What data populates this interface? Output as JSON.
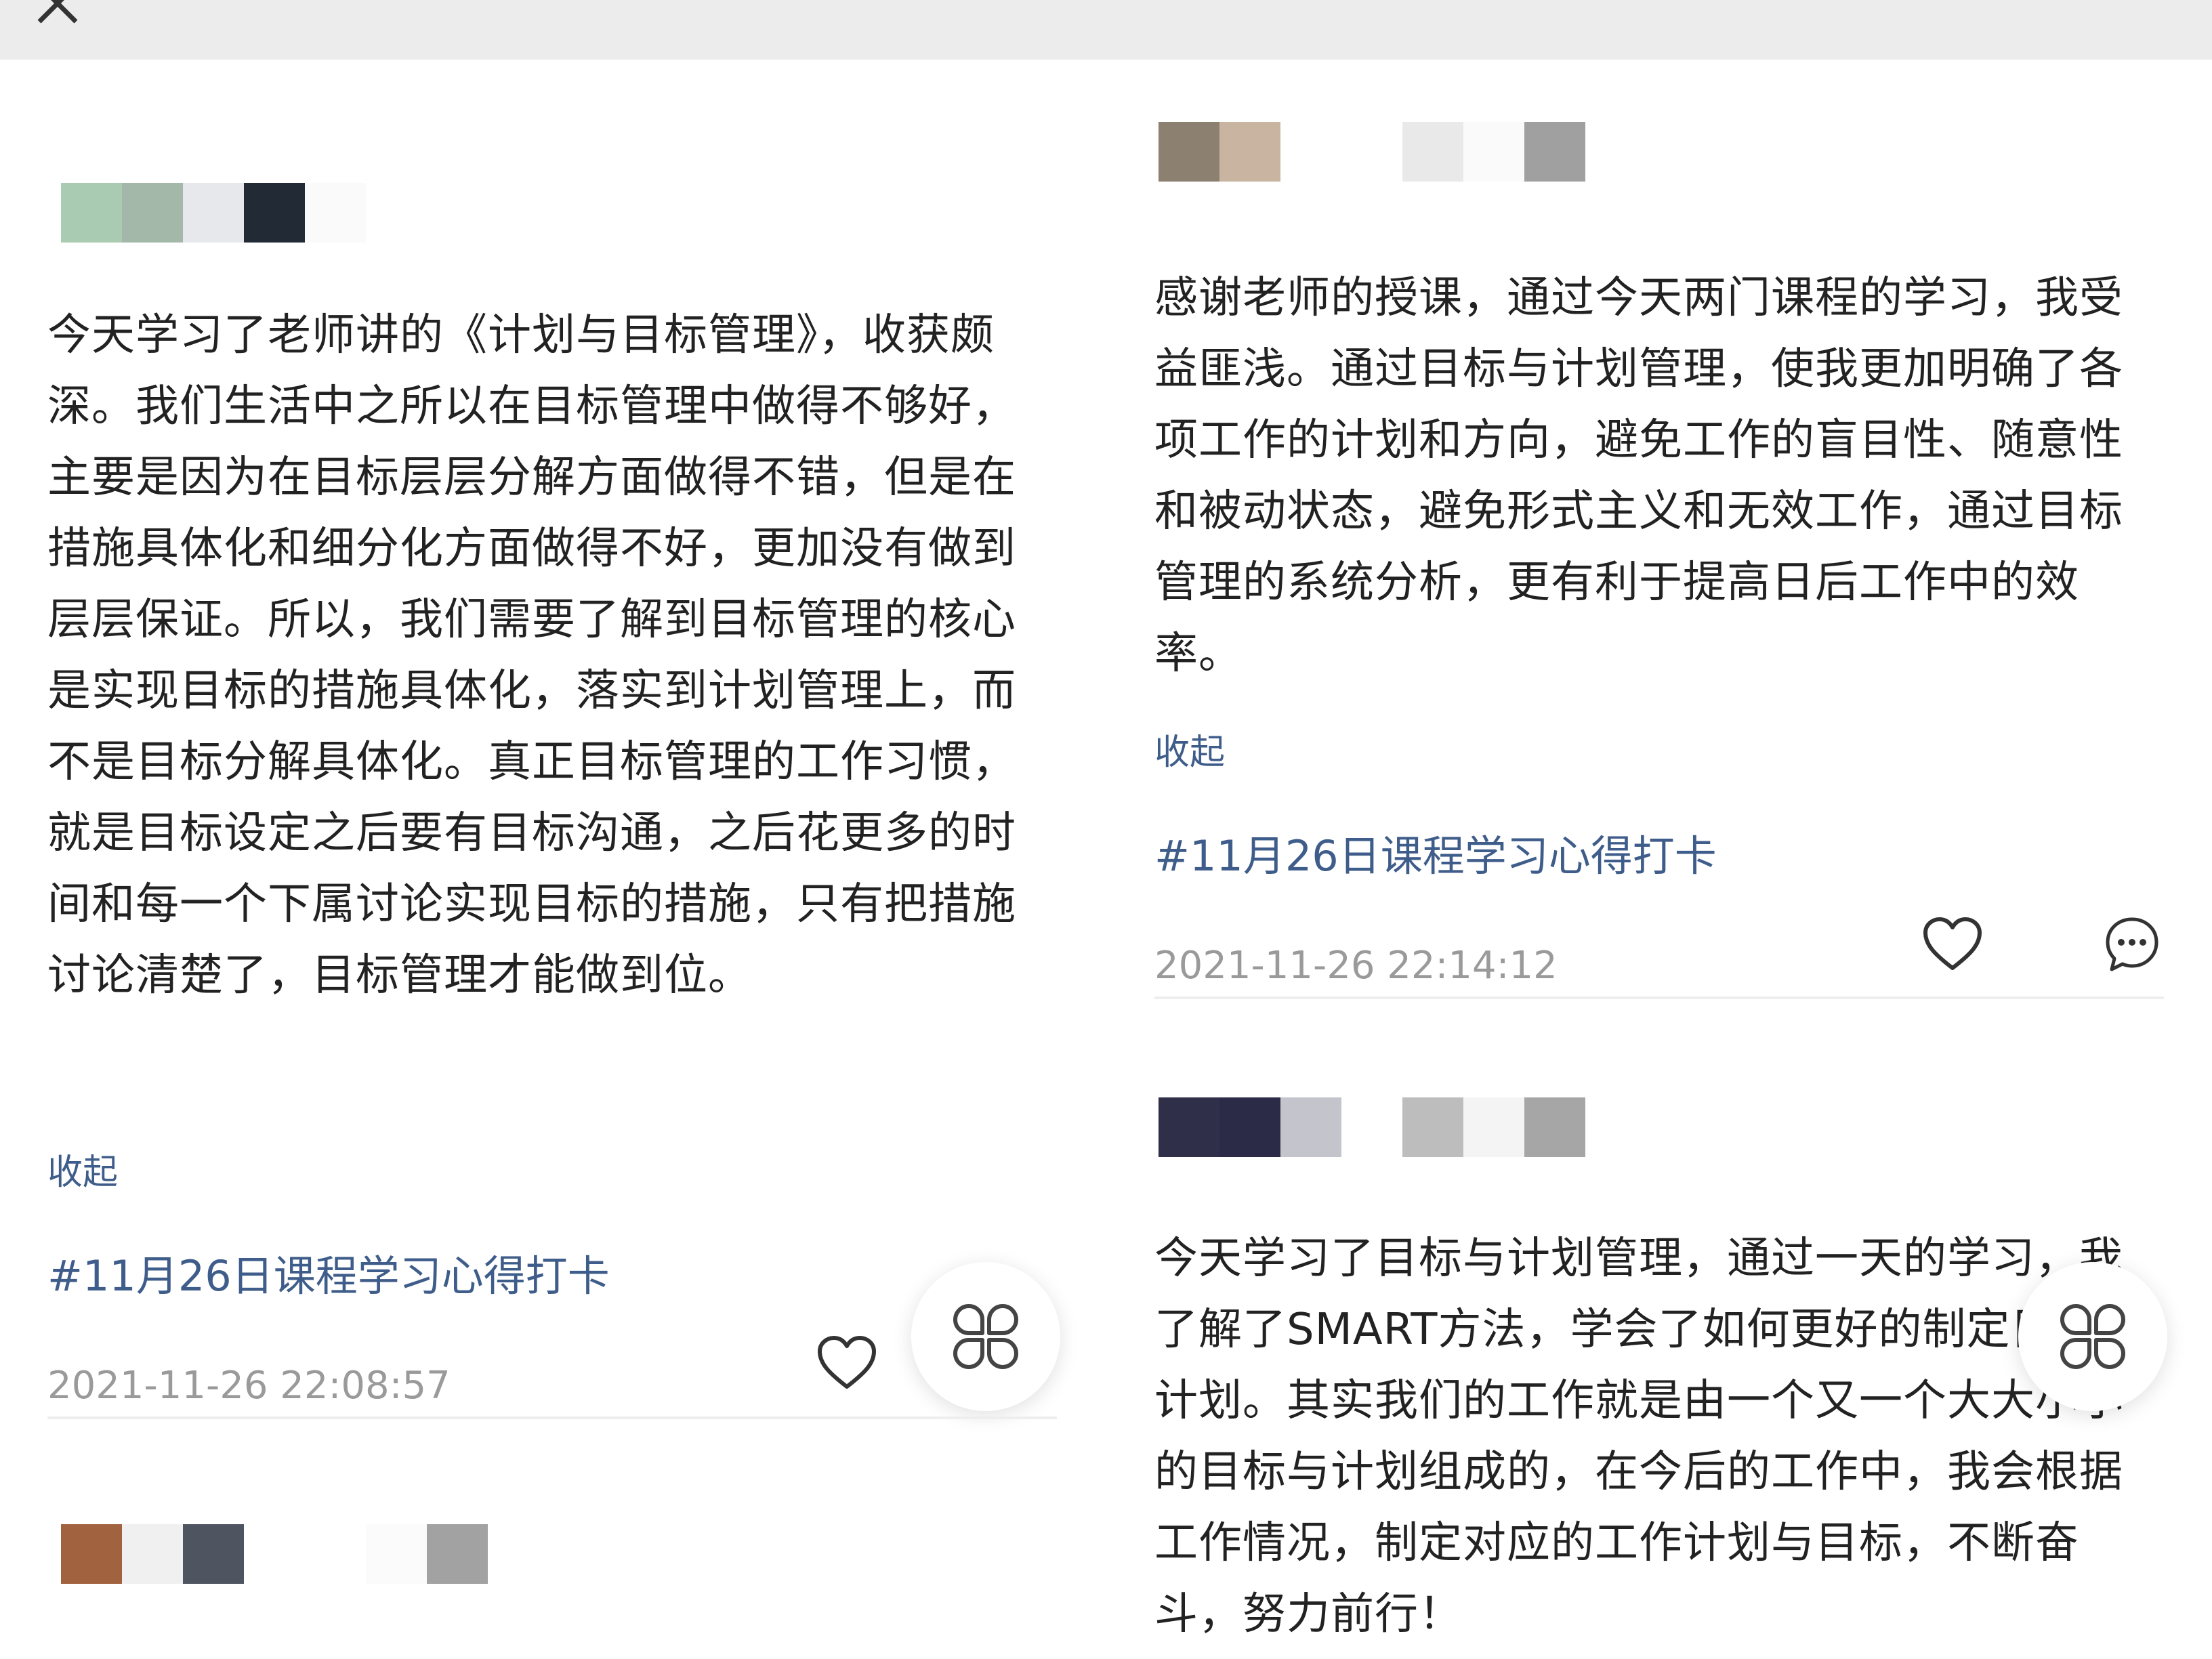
{
  "posts": {
    "left": {
      "text": "今天学习了老师讲的《计划与目标管理》，收获颇深。我们生活中之所以在目标管理中做得不够好，主要是因为在目标层层分解方面做得不错，但是在措施具体化和细分化方面做得不好，更加没有做到层层保证。所以，我们需要了解到目标管理的核心是实现目标的措施具体化，落实到计划管理上，而不是目标分解具体化。真正目标管理的工作习惯，就是目标设定之后要有目标沟通，之后花更多的时间和每一个下属讨论实现目标的措施，只有把措施讨论清楚了，目标管理才能做到位。",
      "collapse_label": "收起",
      "hashtag": "#11月26日课程学习心得打卡",
      "timestamp": "2021-11-26 22:08:57"
    },
    "right_top": {
      "text": "感谢老师的授课，通过今天两门课程的学习，我受益匪浅。通过目标与计划管理，使我更加明确了各项工作的计划和方向，避免工作的盲目性、随意性和被动状态，避免形式主义和无效工作，通过目标管理的系统分析，更有利于提高日后工作中的效率。",
      "collapse_label": "收起",
      "hashtag": "#11月26日课程学习心得打卡",
      "timestamp": "2021-11-26 22:14:12"
    },
    "right_bottom": {
      "text": "今天学习了目标与计划管理，通过一天的学习，我了解了SMART方法，学会了如何更好的制定目标与计划。其实我们的工作就是由一个又一个大大小小的目标与计划组成的，在今后的工作中，我会根据工作情况，制定对应的工作计划与目标，不断奋斗，努力前行！"
    }
  },
  "icons": {
    "close": "close-icon",
    "like": "heart-icon",
    "comment": "comment-bubble-icon",
    "floating": "four-petal-menu-icon"
  },
  "colors": {
    "link": "#3f5d8a",
    "text": "#222222",
    "timestamp": "#9a9a9a",
    "topbar": "#ececec"
  }
}
